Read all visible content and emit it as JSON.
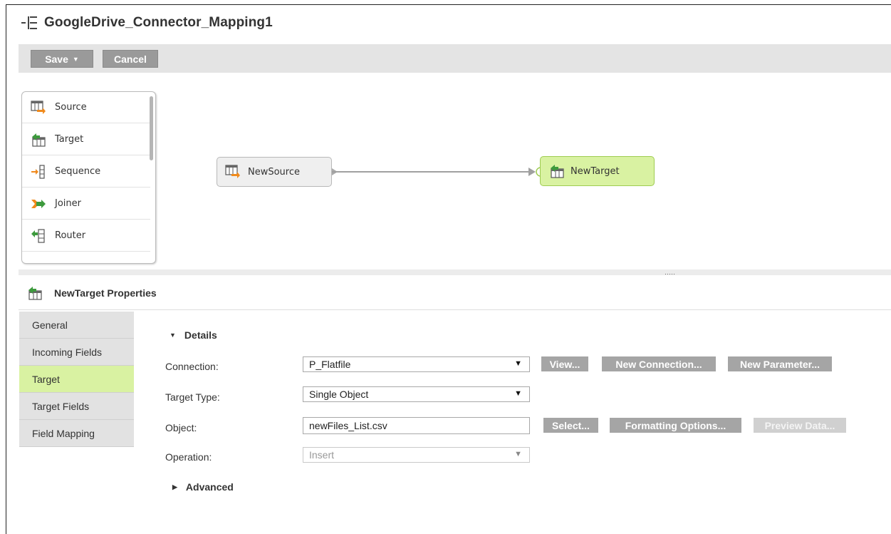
{
  "title": "GoogleDrive_Connector_Mapping1",
  "toolbar": {
    "save_label": "Save",
    "cancel_label": "Cancel"
  },
  "palette": {
    "items": [
      {
        "label": "Source",
        "icon": "source-icon"
      },
      {
        "label": "Target",
        "icon": "target-icon"
      },
      {
        "label": "Sequence",
        "icon": "sequence-icon"
      },
      {
        "label": "Joiner",
        "icon": "joiner-icon"
      },
      {
        "label": "Router",
        "icon": "router-icon"
      }
    ]
  },
  "canvas": {
    "source_node": "NewSource",
    "target_node": "NewTarget"
  },
  "properties": {
    "header": "NewTarget Properties",
    "tabs": [
      {
        "label": "General",
        "active": false
      },
      {
        "label": "Incoming Fields",
        "active": false
      },
      {
        "label": "Target",
        "active": true
      },
      {
        "label": "Target Fields",
        "active": false
      },
      {
        "label": "Field Mapping",
        "active": false
      }
    ],
    "details_label": "Details",
    "advanced_label": "Advanced",
    "connection": {
      "label": "Connection:",
      "value": "P_Flatfile",
      "view_button": "View...",
      "new_connection_button": "New Connection...",
      "new_parameter_button": "New Parameter..."
    },
    "target_type": {
      "label": "Target Type:",
      "value": "Single Object"
    },
    "object": {
      "label": "Object:",
      "value": "newFiles_List.csv",
      "select_button": "Select...",
      "formatting_button": "Formatting Options...",
      "preview_button": "Preview Data..."
    },
    "operation": {
      "label": "Operation:",
      "value": "Insert"
    }
  },
  "colors": {
    "accent_green": "#d9f2a2",
    "button_grey": "#a5a5a5",
    "toolbar_bg": "#e4e4e4"
  }
}
